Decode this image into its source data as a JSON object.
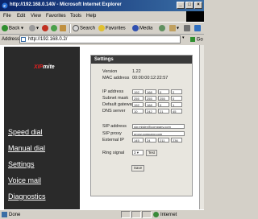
{
  "window": {
    "title": "http://192.168.0.140/ - Microsoft Internet Explorer"
  },
  "menu": [
    "File",
    "Edit",
    "View",
    "Favorites",
    "Tools",
    "Help"
  ],
  "toolbar": {
    "back": "Back",
    "search": "Search",
    "favorites": "Favorites",
    "media": "Media"
  },
  "address": {
    "label": "Address",
    "url": "http://192.168.0.2/",
    "go": "Go"
  },
  "sidebar": {
    "logo_prefix": "XIP",
    "logo_suffix": "mite",
    "nav": [
      "Speed dial",
      "Manual dial",
      "Settings",
      "Voice mail",
      "Diagnostics"
    ]
  },
  "settings": {
    "title": "Settings",
    "version_label": "Version",
    "version": "1.22",
    "mac_label": "MAC address",
    "mac": "00:00:00:12:22:57",
    "ip_label": "IP address",
    "ip": [
      "192",
      "168",
      "0",
      "2"
    ],
    "mask_label": "Subnet mask",
    "mask": [
      "255",
      "255",
      "255",
      "0"
    ],
    "gateway_label": "Default gateway",
    "gateway": [
      "192",
      "168",
      "0",
      "1"
    ],
    "dns_label": "DNS server",
    "dns": [
      "10",
      "242",
      "21",
      "45"
    ],
    "sip_address_label": "SIP address",
    "sip_address": "sip:mister@company.com",
    "sip_proxy_label": "SIP proxy",
    "sip_proxy": "proxy.company.com",
    "external_ip_label": "External IP",
    "external_ip": [
      "145",
      "24",
      "211",
      "236"
    ],
    "ring_label": "Ring signal",
    "ring_value": "3",
    "test_label": "Test",
    "save_label": "Save"
  },
  "status": {
    "done": "Done",
    "zone": "Internet"
  }
}
